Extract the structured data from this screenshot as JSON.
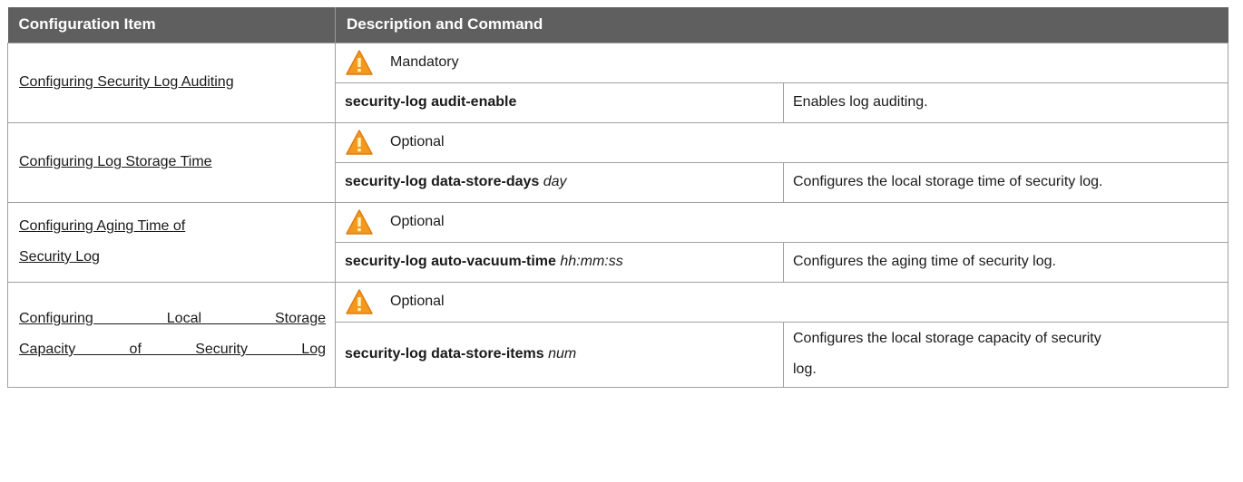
{
  "table": {
    "headers": {
      "item": "Configuration Item",
      "description": "Description and Command"
    },
    "rows": [
      {
        "item": "Configuring Security Log Auditing",
        "requirement": "Mandatory",
        "command": "security-log audit-enable",
        "argument": "",
        "description": "Enables log auditing."
      },
      {
        "item": "Configuring Log Storage Time",
        "requirement": "Optional",
        "command": "security-log data-store-days",
        "argument": "day",
        "description": "Configures the local storage time of security log."
      },
      {
        "item_lines": [
          "Configuring Aging Time of",
          "Security Log"
        ],
        "requirement": "Optional",
        "command": "security-log auto-vacuum-time",
        "argument": "hh:mm:ss",
        "description": "Configures the aging time of security log."
      },
      {
        "item_lines": [
          "Configuring Local Storage",
          "Capacity of Security Log"
        ],
        "requirement": "Optional",
        "command": "security-log data-store-items",
        "argument": "num",
        "description_lines": [
          "Configures the local storage capacity of security",
          "log."
        ]
      }
    ]
  },
  "icons": {
    "requirement": "warning-triangle-icon"
  },
  "colors": {
    "header_bg": "#5f5f5f",
    "warning_orange": "#f39a1e",
    "border": "#a0a0a0"
  }
}
